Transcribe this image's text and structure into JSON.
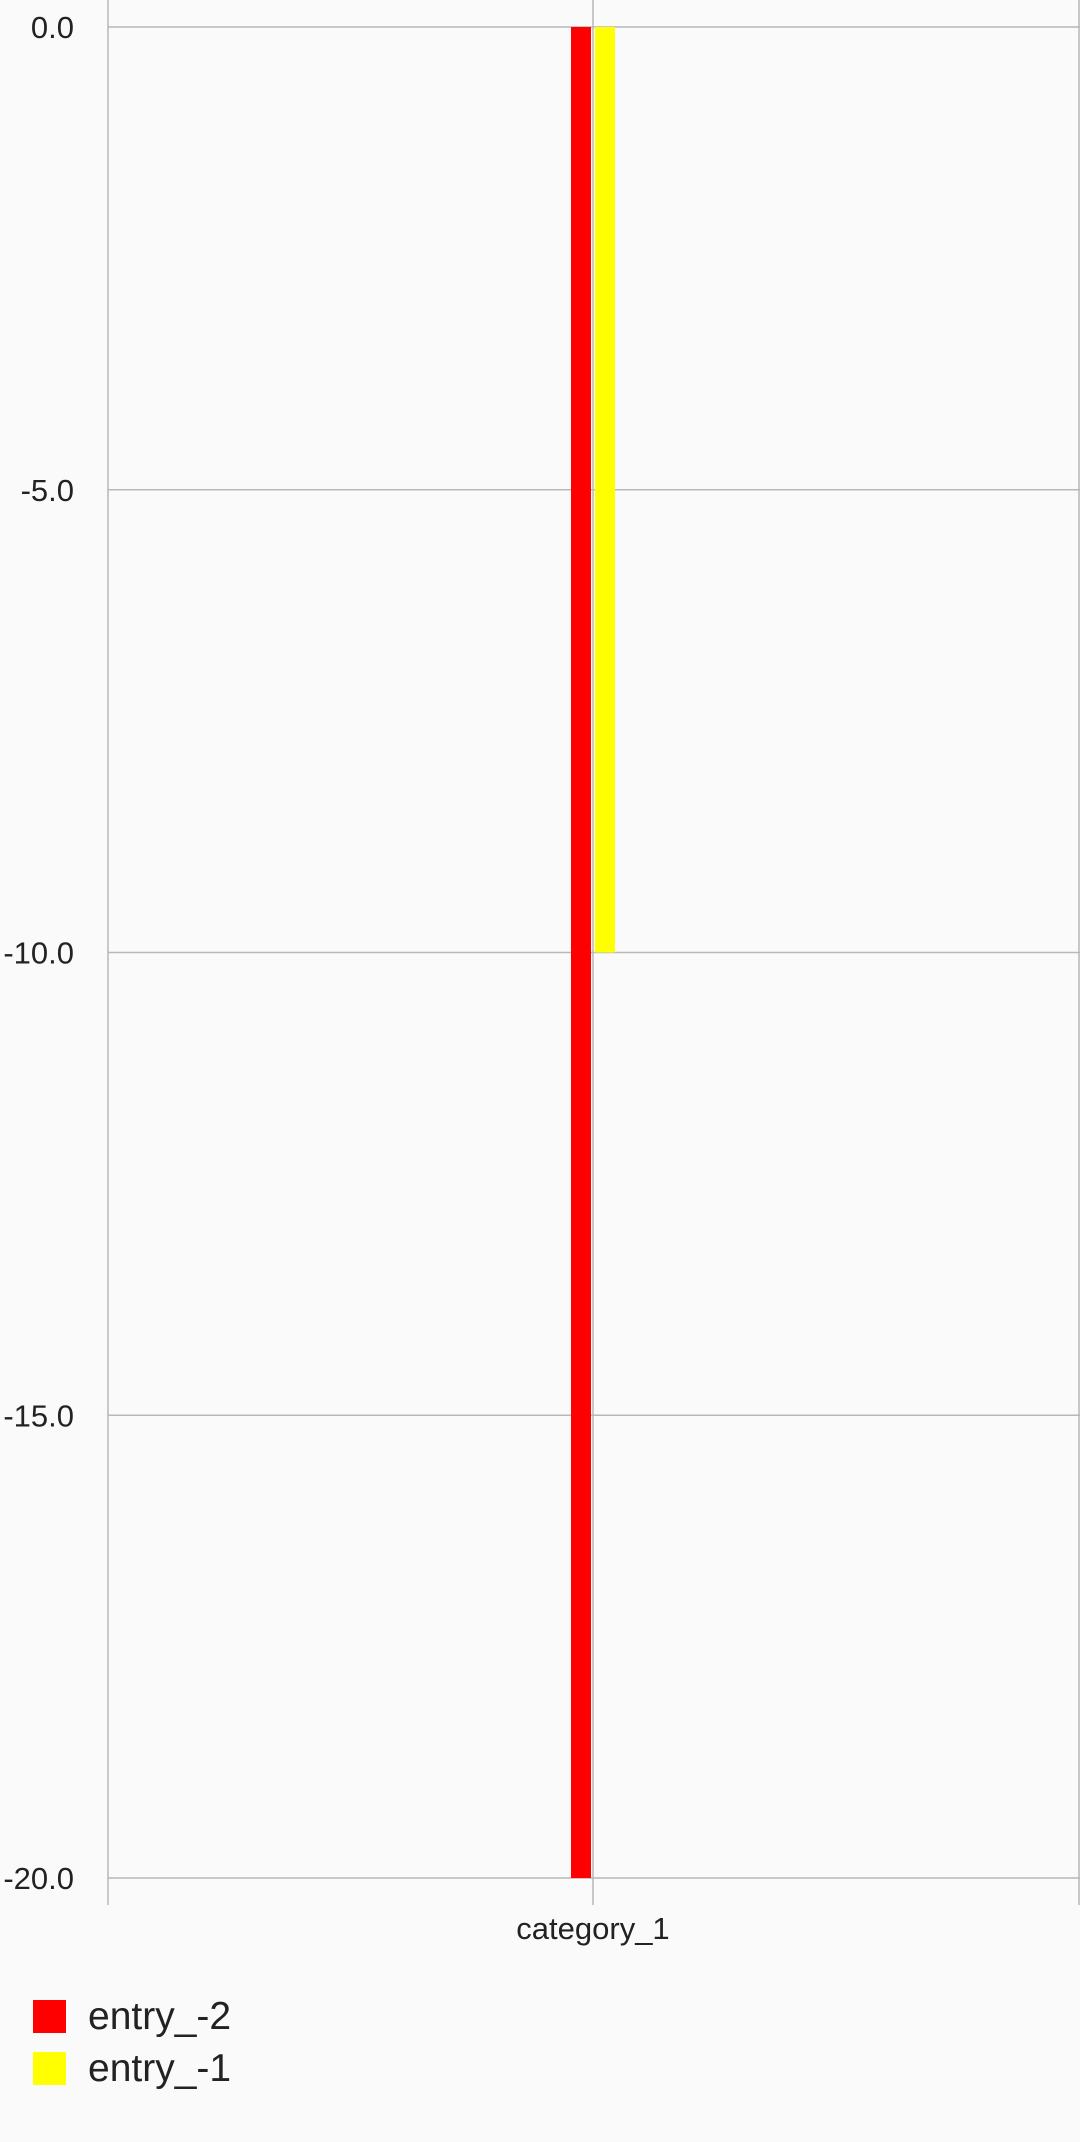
{
  "chart_data": {
    "type": "bar",
    "categories": [
      "category_1"
    ],
    "series": [
      {
        "name": "entry_-2",
        "values": [
          -20
        ],
        "color": "#ff0000"
      },
      {
        "name": "entry_-1",
        "values": [
          -10
        ],
        "color": "#ffff00"
      }
    ],
    "ylim": [
      -20,
      0
    ],
    "yticks": [
      "0.0",
      "-5.0",
      "-10.0",
      "-15.0",
      "-20.0"
    ],
    "grid": true,
    "legend_position": "bottom-left",
    "title": "",
    "xlabel": "",
    "ylabel": ""
  },
  "legend": {
    "items": [
      {
        "label": "entry_-2",
        "color": "#ff0000"
      },
      {
        "label": "entry_-1",
        "color": "#ffff00"
      }
    ]
  }
}
